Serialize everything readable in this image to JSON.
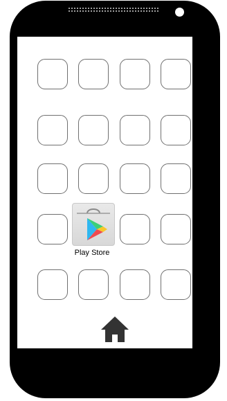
{
  "home_screen": {
    "featured_app": {
      "label": "Play Store",
      "icon": "play-store-icon"
    },
    "empty_slot_count": 19,
    "dock": {
      "home_icon": "home-icon"
    }
  },
  "colors": {
    "phone_body": "#000000",
    "screen_background": "#ffffff",
    "slot_border": "#6f6f6f",
    "home_icon": "#333333"
  }
}
